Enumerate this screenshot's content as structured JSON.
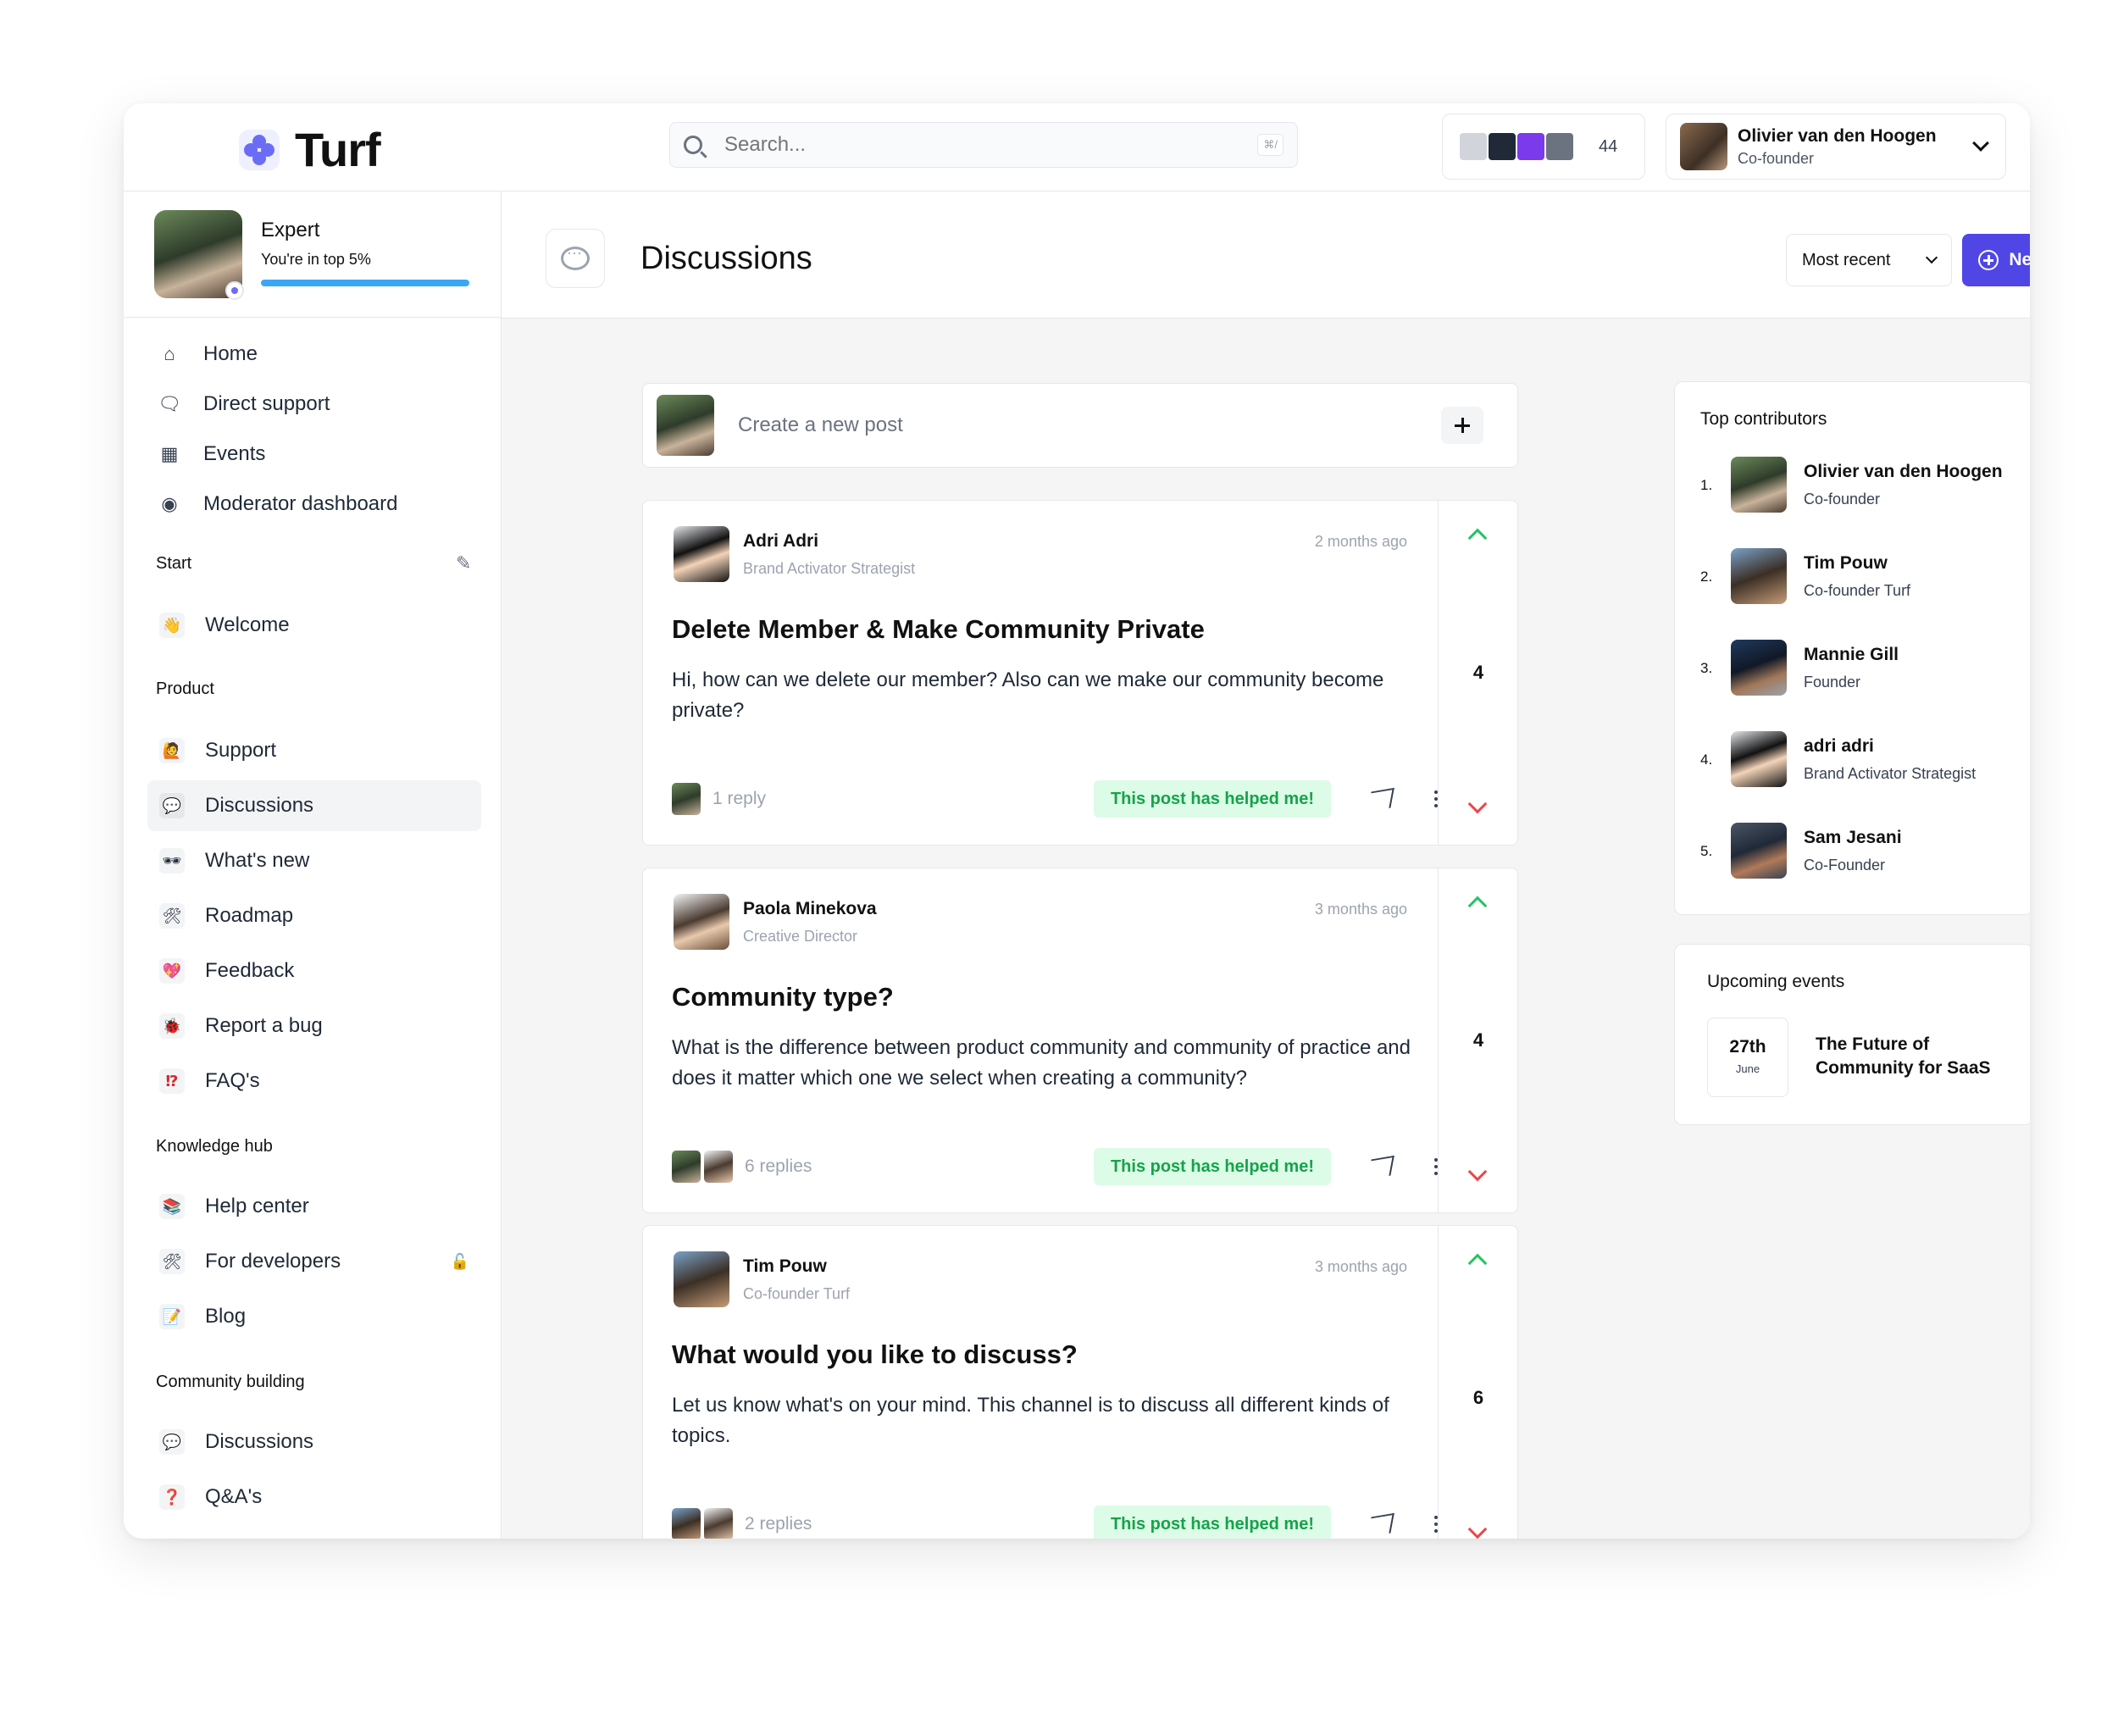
{
  "app": {
    "name": "Turf"
  },
  "search": {
    "placeholder": "Search...",
    "shortcut": "⌘/"
  },
  "header": {
    "member_count": "44",
    "profile": {
      "name": "Olivier van den Hoogen",
      "role": "Co-founder"
    }
  },
  "sidebar": {
    "user_card": {
      "title": "Expert",
      "subtitle": "You're in top 5%",
      "progress": 1.0
    },
    "nav": [
      {
        "label": "Home",
        "icon": "home-icon"
      },
      {
        "label": "Direct support",
        "icon": "chat-icon"
      },
      {
        "label": "Events",
        "icon": "calendar-icon"
      },
      {
        "label": "Moderator dashboard",
        "icon": "eye-icon"
      }
    ],
    "sections": [
      {
        "label": "Start",
        "channels": [
          {
            "label": "Welcome",
            "icon": "👋"
          }
        ]
      },
      {
        "label": "Product",
        "channels": [
          {
            "label": "Support",
            "icon": "🙋"
          },
          {
            "label": "Discussions",
            "icon": "💬",
            "active": true
          },
          {
            "label": "What's new",
            "icon": "🕶"
          },
          {
            "label": "Roadmap",
            "icon": "🛠"
          },
          {
            "label": "Feedback",
            "icon": "💖"
          },
          {
            "label": "Report a bug",
            "icon": "🐞"
          },
          {
            "label": "FAQ's",
            "icon": "⁉"
          }
        ]
      },
      {
        "label": "Knowledge hub",
        "channels": [
          {
            "label": "Help center",
            "icon": "📚"
          },
          {
            "label": "For developers",
            "icon": "🛠",
            "locked": true
          },
          {
            "label": "Blog",
            "icon": "📝"
          }
        ]
      },
      {
        "label": "Community building",
        "channels": [
          {
            "label": "Discussions",
            "icon": "💬"
          },
          {
            "label": "Q&A's",
            "icon": "❓"
          }
        ]
      }
    ]
  },
  "main": {
    "title": "Discussions",
    "sort_label": "Most recent",
    "new_post_label": "New post",
    "create_post_placeholder": "Create a new post",
    "helped_label": "This post has helped me!",
    "posts": [
      {
        "author": "Adri Adri",
        "role": "Brand Activator Strategist",
        "time": "2 months ago",
        "title": "Delete Member & Make Community Private",
        "body": "Hi, how can we delete our member? Also can we make our community become private?",
        "replies": "1 reply",
        "votes": "4"
      },
      {
        "author": "Paola Minekova",
        "role": "Creative Director",
        "time": "3 months ago",
        "title": "Community type?",
        "body": "What is the difference between product community and community of practice and does it matter which one we select when creating a community?",
        "replies": "6 replies",
        "votes": "4"
      },
      {
        "author": "Tim Pouw",
        "role": "Co-founder Turf",
        "time": "3 months ago",
        "title": "What would you like to discuss?",
        "body": "Let us know what's on your mind. This channel is to discuss all different kinds of topics.",
        "replies": "2 replies",
        "votes": "6"
      }
    ]
  },
  "right": {
    "top_contributors_title": "Top contributors",
    "contributors": [
      {
        "rank": "1.",
        "name": "Olivier van den Hoogen",
        "role": "Co-founder"
      },
      {
        "rank": "2.",
        "name": "Tim Pouw",
        "role": "Co-founder Turf"
      },
      {
        "rank": "3.",
        "name": "Mannie Gill",
        "role": "Founder"
      },
      {
        "rank": "4.",
        "name": "adri adri",
        "role": "Brand Activator Strategist"
      },
      {
        "rank": "5.",
        "name": "Sam Jesani",
        "role": "Co-Founder"
      }
    ],
    "events_title": "Upcoming events",
    "event": {
      "day": "27th",
      "month": "June",
      "name": "The Future of Community for SaaS"
    }
  },
  "colors": {
    "accent": "#5046e5",
    "helped_bg": "#dcfce7",
    "helped_text": "#16a34a",
    "upvote": "#22c55e",
    "downvote": "#ef4444",
    "progress": "#3ba6f5"
  }
}
